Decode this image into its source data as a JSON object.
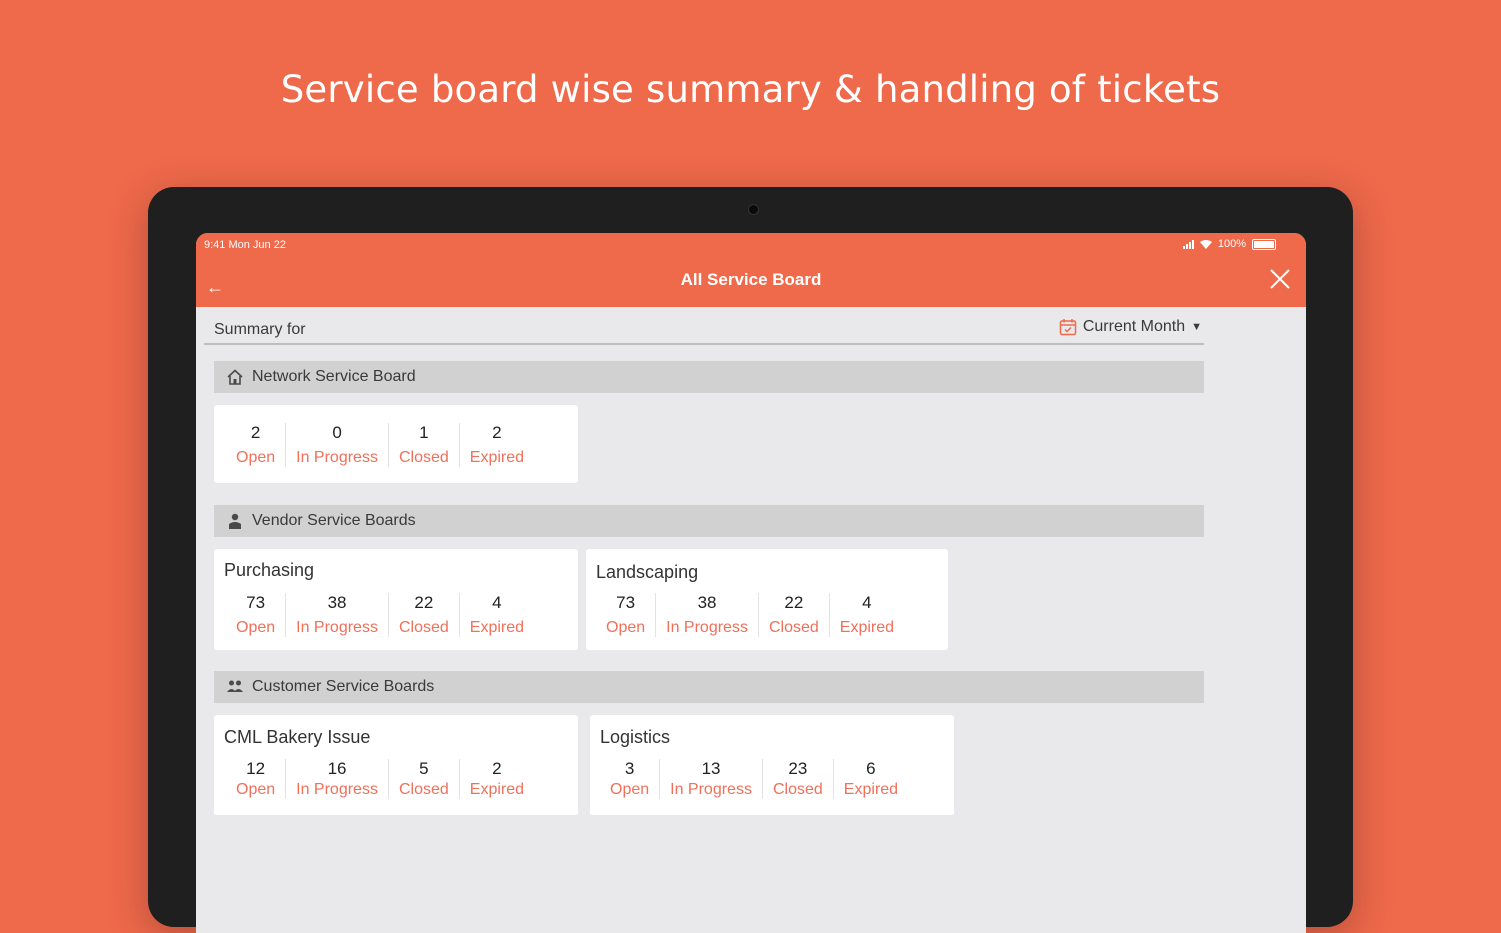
{
  "headline": "Service board wise summary & handling of tickets",
  "status": {
    "time": "9:41  Mon Jun 22",
    "battery": "100%"
  },
  "appbar": {
    "title": "All Service Board"
  },
  "summary": {
    "label": "Summary for",
    "period": "Current Month"
  },
  "network": {
    "title": "Network Service Board",
    "stats": [
      {
        "value": "2",
        "label": "Open"
      },
      {
        "value": "0",
        "label": "In Progress"
      },
      {
        "value": "1",
        "label": "Closed"
      },
      {
        "value": "2",
        "label": "Expired"
      }
    ]
  },
  "vendor": {
    "title": "Vendor Service Boards",
    "boards": [
      {
        "name": "Purchasing",
        "stats": [
          {
            "value": "73",
            "label": "Open"
          },
          {
            "value": "38",
            "label": "In Progress"
          },
          {
            "value": "22",
            "label": "Closed"
          },
          {
            "value": "4",
            "label": "Expired"
          }
        ]
      },
      {
        "name": "Landscaping",
        "stats": [
          {
            "value": "73",
            "label": "Open"
          },
          {
            "value": "38",
            "label": "In Progress"
          },
          {
            "value": "22",
            "label": "Closed"
          },
          {
            "value": "4",
            "label": "Expired"
          }
        ]
      }
    ]
  },
  "customer": {
    "title": "Customer Service Boards",
    "boards": [
      {
        "name": "CML Bakery Issue",
        "stats": [
          {
            "value": "12",
            "label": "Open"
          },
          {
            "value": "16",
            "label": "In Progress"
          },
          {
            "value": "5",
            "label": "Closed"
          },
          {
            "value": "2",
            "label": "Expired"
          }
        ]
      },
      {
        "name": "Logistics",
        "stats": [
          {
            "value": "3",
            "label": "Open"
          },
          {
            "value": "13",
            "label": "In Progress"
          },
          {
            "value": "23",
            "label": "Closed"
          },
          {
            "value": "6",
            "label": "Expired"
          }
        ]
      }
    ]
  },
  "colors": {
    "accent": "#ef694b",
    "label": "#f0705a",
    "screen_bg": "#e9e9eb",
    "section_bg": "#d1d1d1"
  },
  "icons": [
    "back-arrow-icon",
    "close-icon",
    "calendar-icon",
    "caret-down-icon",
    "home-icon",
    "vendor-icon",
    "customers-icon"
  ]
}
